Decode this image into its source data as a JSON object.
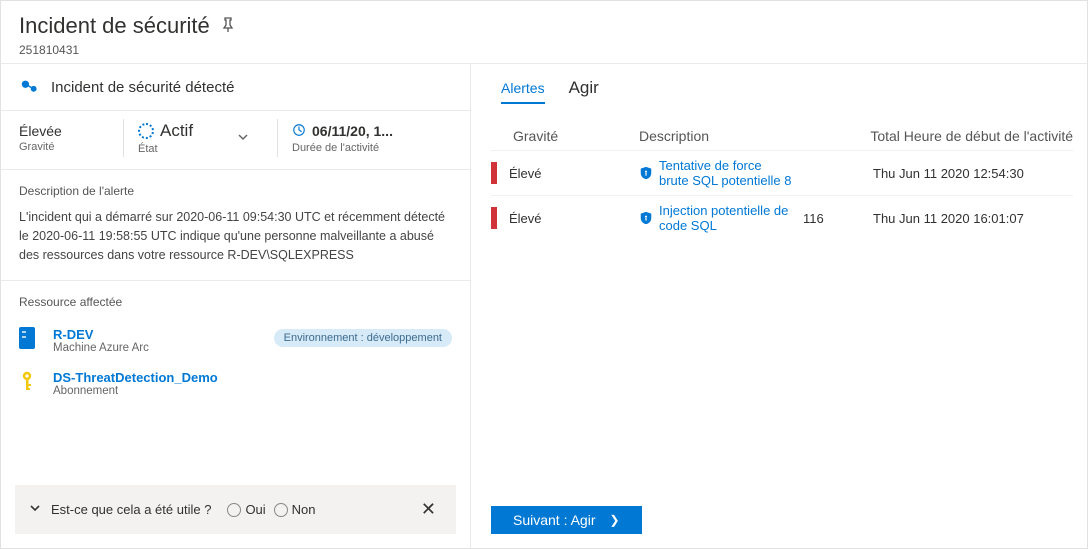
{
  "header": {
    "title": "Incident de sécurité",
    "id": "251810431"
  },
  "left": {
    "banner": "Incident de sécurité détecté",
    "status": {
      "severity": {
        "value": "Élevée",
        "label": "Gravité"
      },
      "state": {
        "value": "Actif",
        "label": "État"
      },
      "duration": {
        "value": "06/11/20, 1...",
        "label": "Durée de l'activité"
      }
    },
    "alert_desc_heading": "Description de l'alerte",
    "alert_desc_text": "L'incident qui a démarré sur 2020-06-11 09:54:30 UTC et récemment détecté le 2020-06-11 19:58:55 UTC indique qu'une personne malveillante a abusé des ressources dans votre ressource R-DEV\\SQLEXPRESS",
    "affected_heading": "Ressource affectée",
    "resources": [
      {
        "name": "R-DEV",
        "type": "Machine Azure Arc",
        "env_tag": "Environnement : développement",
        "icon": "server"
      },
      {
        "name": "DS-ThreatDetection_Demo",
        "type": "Abonnement",
        "env_tag": null,
        "icon": "key"
      }
    ],
    "feedback": {
      "question": "Est-ce que cela a été utile ?",
      "yes": "Oui",
      "no": "Non"
    }
  },
  "right": {
    "tabs": {
      "alerts": "Alertes",
      "act": "Agir"
    },
    "columns": {
      "severity": "Gravité",
      "description": "Description",
      "total_time": "Total Heure de début de l'activité"
    },
    "rows": [
      {
        "severity": "Élevé",
        "description": "Tentative de force brute SQL potentielle 8",
        "total": "",
        "time": "Thu Jun 11 2020 12:54:30"
      },
      {
        "severity": "Élevé",
        "description": "Injection potentielle de code SQL",
        "total": "116",
        "time": "Thu Jun 11 2020 16:01:07"
      }
    ],
    "next_button": "Suivant : Agir"
  }
}
